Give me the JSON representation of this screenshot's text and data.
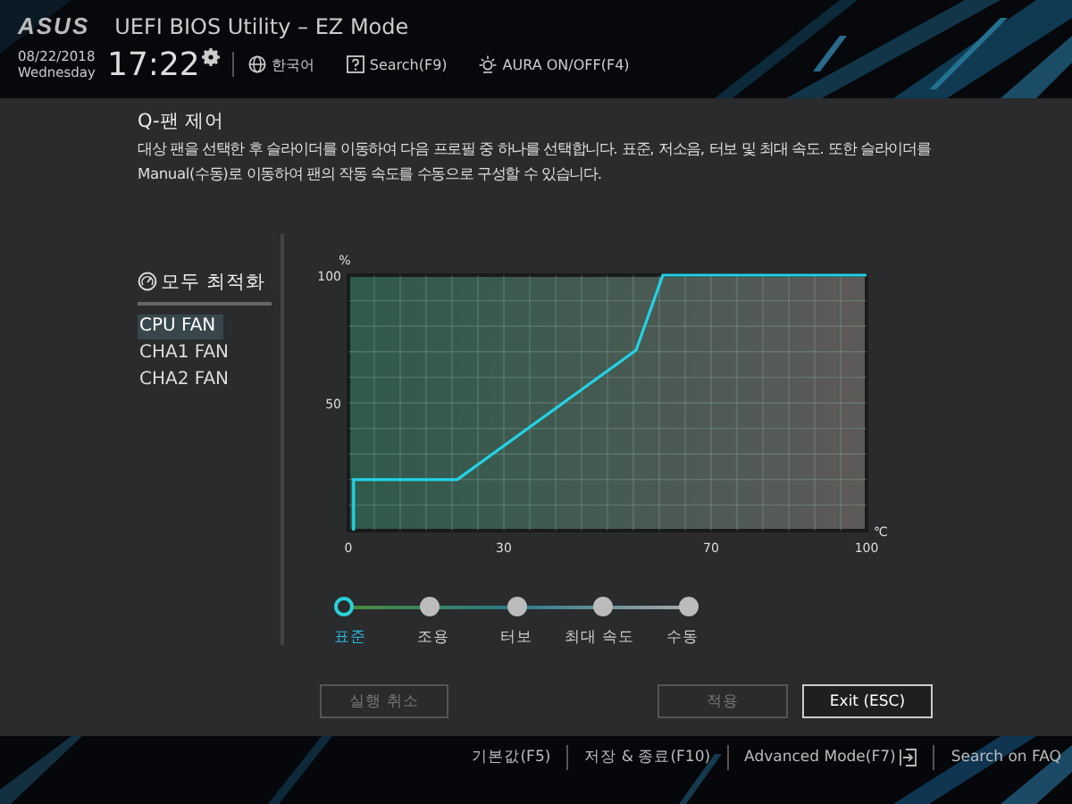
{
  "header": {
    "logo": "ASUS",
    "title": "UEFI BIOS Utility – EZ Mode",
    "date": "08/22/2018",
    "weekday": "Wednesday",
    "time": "17:22",
    "tools": [
      {
        "kind": "language",
        "label": "한국어"
      },
      {
        "kind": "search",
        "label": "Search(F9)"
      },
      {
        "kind": "aura",
        "label": "AURA ON/OFF(F4)"
      }
    ]
  },
  "panel": {
    "title": "Q-팬 제어",
    "description": "대상 팬을 선택한 후 슬라이더를 이동하여 다음 프로필 중 하나를 선택합니다. 표준, 저소음, 터보 및 최대 속도. 또한 슬라이더를 Manual(수동)로 이동하여 팬의 작동 속도를 수동으로 구성할 수 있습니다.",
    "optimize_all": "모두 최적화",
    "fans": [
      {
        "label": "CPU FAN",
        "selected": true
      },
      {
        "label": "CHA1 FAN",
        "selected": false
      },
      {
        "label": "CHA2 FAN",
        "selected": false
      }
    ],
    "chart_data": {
      "type": "line",
      "grid": true,
      "ylabel": "%",
      "xlabel": "℃",
      "xlim": [
        0,
        100
      ],
      "ylim": [
        0,
        100
      ],
      "xticks": [
        0,
        30,
        70,
        100
      ],
      "yticks": [
        50,
        100
      ],
      "series": [
        {
          "color": "#22d3e6",
          "x": [
            1,
            1,
            21,
            55.5,
            60.7,
            100
          ],
          "values": [
            0,
            20,
            20,
            70.6,
            100,
            100
          ]
        }
      ]
    },
    "profiles": [
      {
        "label": "표준",
        "selected": true
      },
      {
        "label": "조용",
        "selected": false
      },
      {
        "label": "터보",
        "selected": false
      },
      {
        "label": "최대 속도",
        "selected": false
      },
      {
        "label": "수동",
        "selected": false
      }
    ],
    "buttons": [
      {
        "label": "실행 취소",
        "disabled": true
      },
      {
        "label": "적용",
        "disabled": true
      },
      {
        "label": "Exit (ESC)",
        "disabled": false
      }
    ]
  },
  "footer": [
    {
      "label": "기본값(F5)",
      "kind": "plain"
    },
    {
      "label": "저장 & 종료(F10)",
      "kind": "plain"
    },
    {
      "label": "Advanced Mode(F7)",
      "kind": "advanced"
    },
    {
      "label": "Search on FAQ",
      "kind": "plain"
    }
  ]
}
